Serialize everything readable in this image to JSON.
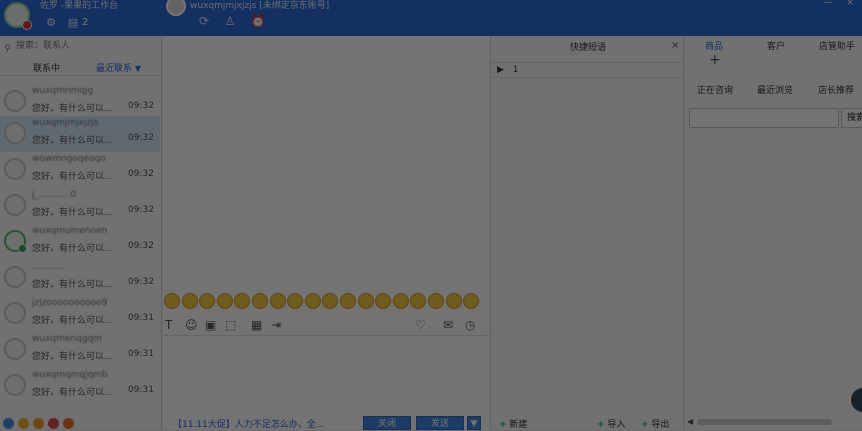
{
  "topbar": {
    "user_name": "佐罗 -果果的工作台",
    "count_badge": "2",
    "chat_title": "wuxqmjmjxjzjs [未绑定京东账号]",
    "window_controls": {
      "minimize": "—",
      "close": "×"
    },
    "icons": [
      "user-avatar-icon",
      "block-status-icon",
      "gear-icon",
      "contact-card-icon",
      "refresh-icon",
      "user-menu-icon",
      "alarm-icon"
    ]
  },
  "sidebar": {
    "search_placeholder": "搜索：联系人",
    "tabs": [
      {
        "label": "联系中"
      },
      {
        "label": "最近联系",
        "caret": "▼"
      }
    ],
    "contacts": [
      {
        "name": "wuxqmnmqjg",
        "message": "您好，有什么可以...",
        "time": "09:32",
        "selected": false,
        "online": false
      },
      {
        "name": "wuxqmjmjxjzjs",
        "message": "您好，有什么可以...",
        "time": "09:32",
        "selected": true,
        "online": false
      },
      {
        "name": "wowmngoqeoqo",
        "message": "您好，有什么可以...",
        "time": "09:32",
        "selected": false,
        "online": false
      },
      {
        "name": "j_...........0",
        "message": "您好，有什么可以...",
        "time": "09:32",
        "selected": false,
        "online": false
      },
      {
        "name": "wuxqmumenoen",
        "message": "您好，有什么可以...",
        "time": "09:32",
        "selected": false,
        "online": true
      },
      {
        "name": "...........",
        "message": "您好，有什么可以...",
        "time": "09:32",
        "selected": false,
        "online": false
      },
      {
        "name": "jzjzoooooooooo9",
        "message": "您好，有什么可以...",
        "time": "09:31",
        "selected": false,
        "online": false
      },
      {
        "name": "wuxqmenqgqm",
        "message": "您好，有什么可以...",
        "time": "09:31",
        "selected": false,
        "online": false
      },
      {
        "name": "wuxqmqmqjqmb",
        "message": "您好，有什么可以...",
        "time": "09:31",
        "selected": false,
        "online": false
      }
    ],
    "bottom_icons": [
      "people-icon",
      "smile-icon",
      "monitor-icon",
      "stop-icon",
      "doc-icon"
    ]
  },
  "chat": {
    "emoji_count": 18,
    "tools": [
      "text-format-icon",
      "emoji-icon",
      "image-icon",
      "screenshot-icon",
      "table-icon",
      "file-send-icon",
      "favorite-icon",
      "quick-reply-icon",
      "history-icon"
    ],
    "promo_text": "【11.11大促】人力不足怎么办，全...",
    "close_button": "关闭",
    "send_button": "发送",
    "send_menu": "▼"
  },
  "phrases": {
    "title": "快捷短语",
    "close": "×",
    "rows": [
      {
        "marker": "▶",
        "label": "1"
      }
    ],
    "footer": {
      "new": "新建",
      "import": "导入",
      "export": "导出"
    }
  },
  "right_panel": {
    "tabs": [
      {
        "label": "商品"
      },
      {
        "label": "客户"
      },
      {
        "label": "店管助手"
      }
    ],
    "add": "+",
    "subtabs": [
      "正在咨询",
      "最近浏览",
      "店长推荐"
    ],
    "search_button": "搜索"
  },
  "colors": {
    "brand": "#2b6bd6",
    "overlay": "rgba(0,0,0,0.55)"
  }
}
